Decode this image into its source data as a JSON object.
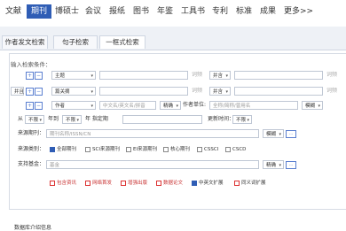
{
  "nav": {
    "items": [
      "文献",
      "期刊",
      "博硕士",
      "会议",
      "报纸",
      "图书",
      "年鉴",
      "工具书",
      "专利",
      "标准",
      "成果",
      "更多>>"
    ],
    "active_index": 1
  },
  "tabs": [
    "作者发文检索",
    "句子检索",
    "一框式检索"
  ],
  "form": {
    "section_title": "输入检索条件：",
    "row1": {
      "field": "主题",
      "freq": "词频",
      "logic": "并含"
    },
    "row2": {
      "op": "并且",
      "field": "篇关摘",
      "freq": "词频",
      "logic": "并含"
    },
    "row3": {
      "field": "作者",
      "placeholder": "中文名/英文名/拼音",
      "match": "精确",
      "unit_label": "作者单位:",
      "unit_placeholder": "全称/简称/曾用名",
      "fuzzy": "模糊"
    },
    "row4": {
      "from_label": "从",
      "from_val": "不限",
      "year_label": "年到",
      "to_val": "不限",
      "period_label": "年 指定期",
      "update_label": "更新时间：",
      "update_val": "不限"
    },
    "source": {
      "label": "来源期刊：",
      "placeholder": "期刊名称/ISSN/CN",
      "match": "模糊",
      "more": "···"
    },
    "source_type": {
      "label": "来源类别：",
      "options": [
        {
          "label": "全部期刊",
          "checked": true
        },
        {
          "label": "SCI来源期刊",
          "checked": false
        },
        {
          "label": "EI来源期刊",
          "checked": false
        },
        {
          "label": "核心期刊",
          "checked": false
        },
        {
          "label": "CSSCI",
          "checked": false
        },
        {
          "label": "CSCD",
          "checked": false
        }
      ]
    },
    "fund": {
      "label": "支持基金：",
      "placeholder": "基金",
      "match": "精确",
      "more": "···"
    },
    "extras": [
      {
        "label": "包含资讯",
        "checked": false,
        "red": true
      },
      {
        "label": "网络首发",
        "checked": false,
        "red": true
      },
      {
        "label": "增强出版",
        "checked": false,
        "red": true
      },
      {
        "label": "数据论文",
        "checked": false,
        "red": true
      },
      {
        "label": "中英文扩展",
        "checked": true,
        "red": false
      },
      {
        "label": "同义词扩展",
        "checked": false,
        "red": false
      }
    ]
  },
  "footer": {
    "text": "数据库介绍信息"
  }
}
